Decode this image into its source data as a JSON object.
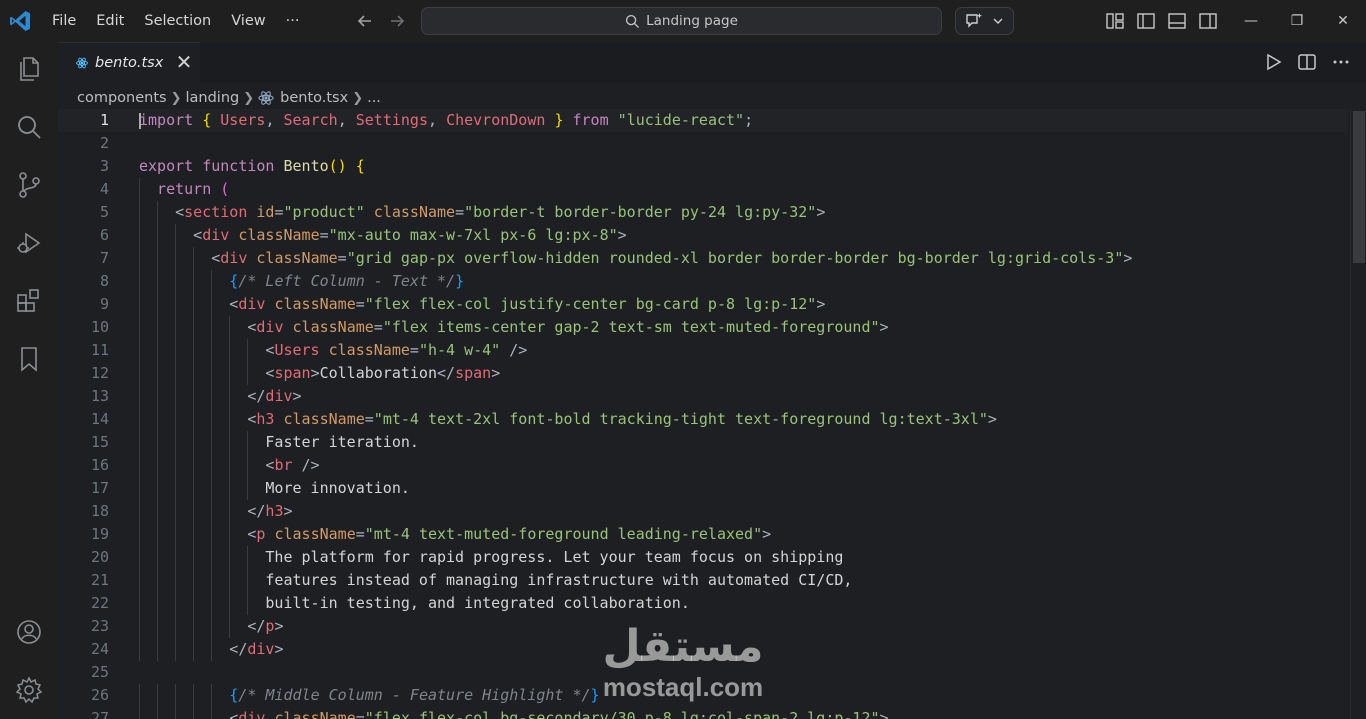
{
  "menu": [
    "File",
    "Edit",
    "Selection",
    "View",
    "···"
  ],
  "search": {
    "text": "Landing page"
  },
  "window_controls": [
    "—",
    "❐",
    "✕"
  ],
  "tab": {
    "name": "bento.tsx",
    "close": "✕"
  },
  "breadcrumb": {
    "parts": [
      "components",
      "landing",
      "bento.tsx",
      "..."
    ]
  },
  "colors": {
    "accent": "#007acc",
    "string": "#98c379",
    "tag": "#e06c75",
    "attribute": "#d19a66",
    "keyword": "#c586c0"
  },
  "code": {
    "lines": [
      {
        "n": "1",
        "indent": 0,
        "tokens": [
          [
            "kw",
            "import"
          ],
          [
            "pun",
            " "
          ],
          [
            "br",
            "{"
          ],
          [
            "pun",
            " "
          ],
          [
            "id",
            "Users"
          ],
          [
            "pun",
            ", "
          ],
          [
            "id",
            "Search"
          ],
          [
            "pun",
            ", "
          ],
          [
            "id",
            "Settings"
          ],
          [
            "pun",
            ", "
          ],
          [
            "id",
            "ChevronDown"
          ],
          [
            "pun",
            " "
          ],
          [
            "br",
            "}"
          ],
          [
            "pun",
            " "
          ],
          [
            "kw",
            "from"
          ],
          [
            "pun",
            " "
          ],
          [
            "strg",
            "\"lucide-react\""
          ],
          [
            "pun",
            ";"
          ]
        ]
      },
      {
        "n": "2",
        "indent": 0,
        "tokens": []
      },
      {
        "n": "3",
        "indent": 0,
        "tokens": [
          [
            "kw",
            "export"
          ],
          [
            "pun",
            " "
          ],
          [
            "kw",
            "function"
          ],
          [
            "pun",
            " "
          ],
          [
            "fn",
            "Bento"
          ],
          [
            "br",
            "()"
          ],
          [
            "pun",
            " "
          ],
          [
            "br",
            "{"
          ]
        ]
      },
      {
        "n": "4",
        "indent": 1,
        "tokens": [
          [
            "kw",
            "return"
          ],
          [
            "pun",
            " "
          ],
          [
            "br2",
            "("
          ]
        ]
      },
      {
        "n": "5",
        "indent": 2,
        "tokens": [
          [
            "pun",
            "<"
          ],
          [
            "tag",
            "section"
          ],
          [
            "pun",
            " "
          ],
          [
            "attr",
            "id"
          ],
          [
            "pun",
            "="
          ],
          [
            "strg",
            "\"product\""
          ],
          [
            "pun",
            " "
          ],
          [
            "attr",
            "className"
          ],
          [
            "pun",
            "="
          ],
          [
            "strg",
            "\"border-t border-border py-24 lg:py-32\""
          ],
          [
            "pun",
            ">"
          ]
        ]
      },
      {
        "n": "6",
        "indent": 3,
        "tokens": [
          [
            "pun",
            "<"
          ],
          [
            "tag",
            "div"
          ],
          [
            "pun",
            " "
          ],
          [
            "attr",
            "className"
          ],
          [
            "pun",
            "="
          ],
          [
            "strg",
            "\"mx-auto max-w-7xl px-6 lg:px-8\""
          ],
          [
            "pun",
            ">"
          ]
        ]
      },
      {
        "n": "7",
        "indent": 4,
        "tokens": [
          [
            "pun",
            "<"
          ],
          [
            "tag",
            "div"
          ],
          [
            "pun",
            " "
          ],
          [
            "attr",
            "className"
          ],
          [
            "pun",
            "="
          ],
          [
            "strg",
            "\"grid gap-px overflow-hidden rounded-xl border border-border bg-border lg:grid-cols-3\""
          ],
          [
            "pun",
            ">"
          ]
        ]
      },
      {
        "n": "8",
        "indent": 5,
        "tokens": [
          [
            "br3",
            "{"
          ],
          [
            "com",
            "/* Left Column - Text */"
          ],
          [
            "br3",
            "}"
          ]
        ]
      },
      {
        "n": "9",
        "indent": 5,
        "tokens": [
          [
            "pun",
            "<"
          ],
          [
            "tag",
            "div"
          ],
          [
            "pun",
            " "
          ],
          [
            "attr",
            "className"
          ],
          [
            "pun",
            "="
          ],
          [
            "strg",
            "\"flex flex-col justify-center bg-card p-8 lg:p-12\""
          ],
          [
            "pun",
            ">"
          ]
        ]
      },
      {
        "n": "10",
        "indent": 6,
        "tokens": [
          [
            "pun",
            "<"
          ],
          [
            "tag",
            "div"
          ],
          [
            "pun",
            " "
          ],
          [
            "attr",
            "className"
          ],
          [
            "pun",
            "="
          ],
          [
            "strg",
            "\"flex items-center gap-2 text-sm text-muted-foreground\""
          ],
          [
            "pun",
            ">"
          ]
        ]
      },
      {
        "n": "11",
        "indent": 7,
        "tokens": [
          [
            "pun",
            "<"
          ],
          [
            "tag",
            "Users"
          ],
          [
            "pun",
            " "
          ],
          [
            "attr",
            "className"
          ],
          [
            "pun",
            "="
          ],
          [
            "strg",
            "\"h-4 w-4\""
          ],
          [
            "pun",
            " />"
          ]
        ]
      },
      {
        "n": "12",
        "indent": 7,
        "tokens": [
          [
            "pun",
            "<"
          ],
          [
            "tag",
            "span"
          ],
          [
            "pun",
            ">"
          ],
          [
            "txt",
            "Collaboration"
          ],
          [
            "pun",
            "</"
          ],
          [
            "tag",
            "span"
          ],
          [
            "pun",
            ">"
          ]
        ]
      },
      {
        "n": "13",
        "indent": 6,
        "tokens": [
          [
            "pun",
            "</"
          ],
          [
            "tag",
            "div"
          ],
          [
            "pun",
            ">"
          ]
        ]
      },
      {
        "n": "14",
        "indent": 6,
        "tokens": [
          [
            "pun",
            "<"
          ],
          [
            "tag",
            "h3"
          ],
          [
            "pun",
            " "
          ],
          [
            "attr",
            "className"
          ],
          [
            "pun",
            "="
          ],
          [
            "strg",
            "\"mt-4 text-2xl font-bold tracking-tight text-foreground lg:text-3xl\""
          ],
          [
            "pun",
            ">"
          ]
        ]
      },
      {
        "n": "15",
        "indent": 7,
        "tokens": [
          [
            "txt",
            "Faster iteration."
          ]
        ]
      },
      {
        "n": "16",
        "indent": 7,
        "tokens": [
          [
            "pun",
            "<"
          ],
          [
            "tag",
            "br"
          ],
          [
            "pun",
            " />"
          ]
        ]
      },
      {
        "n": "17",
        "indent": 7,
        "tokens": [
          [
            "txt",
            "More innovation."
          ]
        ]
      },
      {
        "n": "18",
        "indent": 6,
        "tokens": [
          [
            "pun",
            "</"
          ],
          [
            "tag",
            "h3"
          ],
          [
            "pun",
            ">"
          ]
        ]
      },
      {
        "n": "19",
        "indent": 6,
        "tokens": [
          [
            "pun",
            "<"
          ],
          [
            "tag",
            "p"
          ],
          [
            "pun",
            " "
          ],
          [
            "attr",
            "className"
          ],
          [
            "pun",
            "="
          ],
          [
            "strg",
            "\"mt-4 text-muted-foreground leading-relaxed\""
          ],
          [
            "pun",
            ">"
          ]
        ]
      },
      {
        "n": "20",
        "indent": 7,
        "tokens": [
          [
            "txt",
            "The platform for rapid progress. Let your team focus on shipping"
          ]
        ]
      },
      {
        "n": "21",
        "indent": 7,
        "tokens": [
          [
            "txt",
            "features instead of managing infrastructure with automated CI/CD,"
          ]
        ]
      },
      {
        "n": "22",
        "indent": 7,
        "tokens": [
          [
            "txt",
            "built-in testing, and integrated collaboration."
          ]
        ]
      },
      {
        "n": "23",
        "indent": 6,
        "tokens": [
          [
            "pun",
            "</"
          ],
          [
            "tag",
            "p"
          ],
          [
            "pun",
            ">"
          ]
        ]
      },
      {
        "n": "24",
        "indent": 5,
        "tokens": [
          [
            "pun",
            "</"
          ],
          [
            "tag",
            "div"
          ],
          [
            "pun",
            ">"
          ]
        ]
      },
      {
        "n": "25",
        "indent": 0,
        "tokens": []
      },
      {
        "n": "26",
        "indent": 5,
        "tokens": [
          [
            "br3",
            "{"
          ],
          [
            "com",
            "/* Middle Column - Feature Highlight */"
          ],
          [
            "br3",
            "}"
          ]
        ]
      },
      {
        "n": "27",
        "indent": 5,
        "tokens": [
          [
            "pun",
            "<"
          ],
          [
            "tag",
            "div"
          ],
          [
            "pun",
            " "
          ],
          [
            "attr",
            "className"
          ],
          [
            "pun",
            "="
          ],
          [
            "strg",
            "\"flex flex-col bg-secondary/30 p-8 lg:col-span-2 lg:p-12\""
          ],
          [
            "pun",
            ">"
          ]
        ]
      }
    ]
  },
  "icons": {
    "activity": [
      "explorer-icon",
      "search-icon",
      "source-control-icon",
      "run-debug-icon",
      "extensions-icon",
      "bookmark-icon",
      "account-icon",
      "settings-gear-icon"
    ],
    "layout": [
      "customize-layout-icon",
      "toggle-primary-sidebar-icon",
      "toggle-panel-icon",
      "toggle-secondary-sidebar-icon"
    ],
    "tab_actions": [
      "run-icon",
      "split-editor-icon",
      "more-actions-icon"
    ]
  },
  "watermark": {
    "arabic": "مستقل",
    "latin": "mostaql.com"
  }
}
